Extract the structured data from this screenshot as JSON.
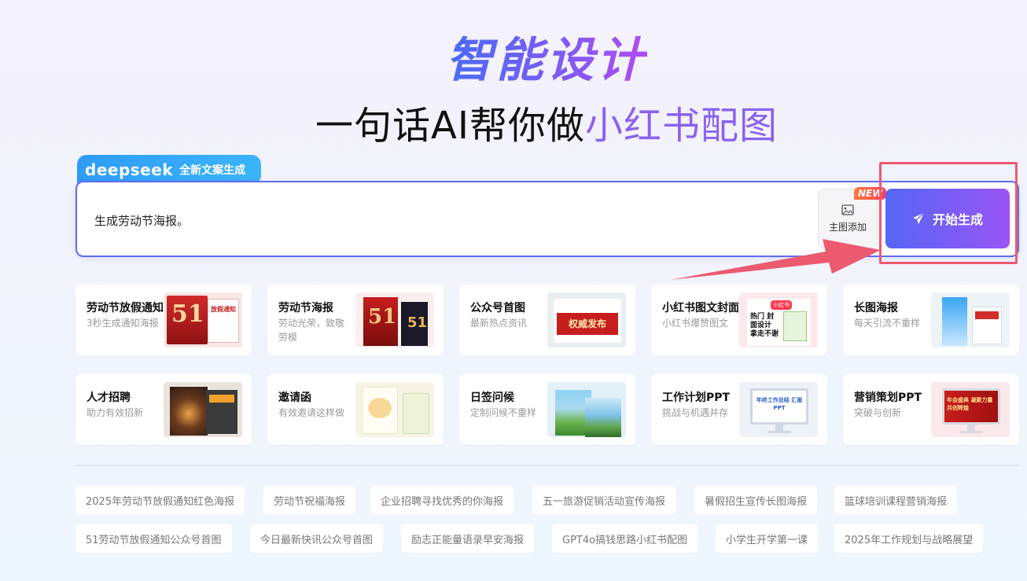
{
  "hero": {
    "title": "智能设计",
    "subtitle_prefix": "一句话AI帮你做",
    "subtitle_highlight": "小红书配图"
  },
  "deepseek_badge": {
    "logo": "deepseek",
    "text": "全新文案生成"
  },
  "prompt": {
    "value": "生成劳动节海报。"
  },
  "main_image_button": {
    "icon": "image-icon",
    "label": "主图添加",
    "badge": "NEW"
  },
  "start_button": {
    "icon": "paper-plane-icon",
    "label": "开始生成"
  },
  "templates": [
    {
      "title": "劳动节放假通知",
      "desc": "3秒生成通知海报"
    },
    {
      "title": "劳动节海报",
      "desc": "劳动光荣，致敬劳模"
    },
    {
      "title": "公众号首图",
      "desc": "最新热点资讯"
    },
    {
      "title": "小红书图文封面",
      "desc": "小红书爆赞图文"
    },
    {
      "title": "长图海报",
      "desc": "每天引流不重样"
    },
    {
      "title": "人才招聘",
      "desc": "助力有效招新"
    },
    {
      "title": "邀请函",
      "desc": "有效邀请这样做"
    },
    {
      "title": "日签问候",
      "desc": "定制问候不重样"
    },
    {
      "title": "工作计划PPT",
      "desc": "挑战与机遇并存"
    },
    {
      "title": "营销策划PPT",
      "desc": "突破与创新"
    }
  ],
  "thumb_text": {
    "labor_notice_51": "51",
    "labor_notice_label": "放假通知",
    "labor_poster_51": "51",
    "wechat_cover": "权威发布",
    "rednote_badge": "小红书",
    "rednote_text": "热门 封面设计 拿走不谢",
    "ppt_work": "年终工作总结 汇报PPT",
    "ppt_marketing": "年会盛典 凝聚力量 共创辉煌"
  },
  "tags_row1": [
    "2025年劳动节放假通知红色海报",
    "劳动节祝福海报",
    "企业招聘寻找优秀的你海报",
    "五一旅游促销活动宣传海报",
    "暑假招生宣传长图海报",
    "篮球培训课程营销海报"
  ],
  "tags_row2": [
    "51劳动节放假通知公众号首图",
    "今日最新快讯公众号首图",
    "励志正能量语录早安海报",
    "GPT4o搞钱思路小红书配图",
    "小学生开学第一课",
    "2025年工作规划与战略展望"
  ],
  "colors": {
    "accent": "#5f6cf2",
    "gradient_start": "#5566f5",
    "gradient_end": "#9a55f5",
    "deepseek_blue": "#2f9cf8",
    "annotation_red": "#ec5a70"
  }
}
